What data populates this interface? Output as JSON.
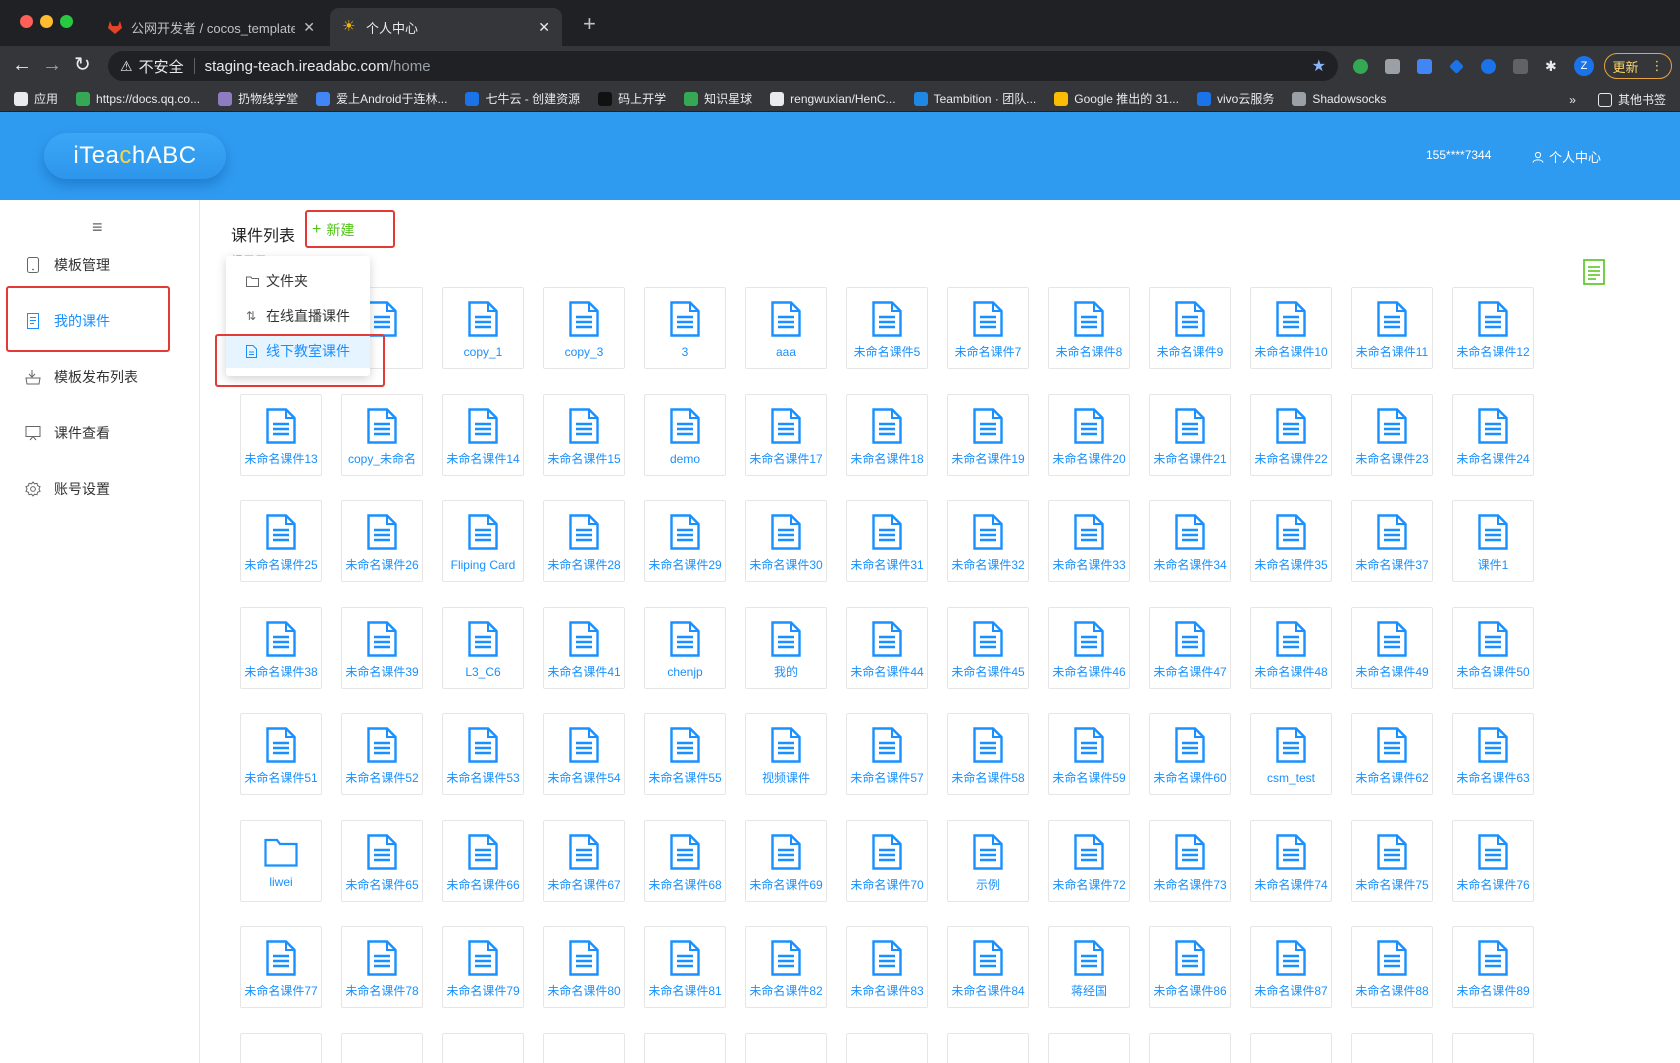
{
  "browser": {
    "tabs": [
      {
        "title": "公网开发者 / cocos_template_",
        "active": false
      },
      {
        "title": "个人中心",
        "active": true
      }
    ],
    "security_label": "不安全",
    "url_host": "staging-teach.ireadabc.com",
    "url_path": "/home",
    "profile_initial": "Z",
    "update_label": "更新",
    "bookmarks": [
      {
        "label": "应用",
        "color": "#e8eaed"
      },
      {
        "label": "https://docs.qq.co...",
        "color": "#34a853"
      },
      {
        "label": "扔物线学堂",
        "color": "#8e7cc3"
      },
      {
        "label": "爱上Android于连林...",
        "color": "#4285f4"
      },
      {
        "label": "七牛云 - 创建资源",
        "color": "#1a73e8"
      },
      {
        "label": "码上开学",
        "color": "#111111"
      },
      {
        "label": "知识星球",
        "color": "#34a853"
      },
      {
        "label": "rengwuxian/HenC...",
        "color": "#e8eaed"
      },
      {
        "label": "Teambition · 团队...",
        "color": "#1e88e5"
      },
      {
        "label": "Google 推出的 31...",
        "color": "#fbbc04"
      },
      {
        "label": "vivo云服务",
        "color": "#1a73e8"
      },
      {
        "label": "Shadowsocks",
        "color": "#9aa0a6"
      }
    ],
    "bookmarks_more": "»",
    "other_bookmarks": "其他书签"
  },
  "header": {
    "logo_pre": "iTea",
    "logo_accent": "c",
    "logo_post": "hABC",
    "phone": "155****7344",
    "user_center": "个人中心"
  },
  "sidebar": {
    "items": [
      {
        "label": "模板管理",
        "icon": "tablet-icon",
        "active": false
      },
      {
        "label": "我的课件",
        "icon": "document-icon",
        "active": true
      },
      {
        "label": "模板发布列表",
        "icon": "publish-icon",
        "active": false
      },
      {
        "label": "课件查看",
        "icon": "monitor-icon",
        "active": false
      },
      {
        "label": "账号设置",
        "icon": "gear-icon",
        "active": false
      }
    ]
  },
  "main": {
    "title": "课件列表",
    "new_label": "新建",
    "hidden_label": "根目录",
    "dropdown": [
      {
        "label": "文件夹",
        "icon": "folder-icon"
      },
      {
        "label": "在线直播课件",
        "icon": "sort-icon"
      },
      {
        "label": "线下教室课件",
        "icon": "file-icon"
      }
    ],
    "items": [
      {
        "label": "",
        "type": "file"
      },
      {
        "label": "",
        "type": "file"
      },
      {
        "label": "copy_1",
        "type": "file"
      },
      {
        "label": "copy_3",
        "type": "file"
      },
      {
        "label": "3",
        "type": "file"
      },
      {
        "label": "aaa",
        "type": "file"
      },
      {
        "label": "未命名课件5",
        "type": "file"
      },
      {
        "label": "未命名课件7",
        "type": "file"
      },
      {
        "label": "未命名课件8",
        "type": "file"
      },
      {
        "label": "未命名课件9",
        "type": "file"
      },
      {
        "label": "未命名课件10",
        "type": "file"
      },
      {
        "label": "未命名课件11",
        "type": "file"
      },
      {
        "label": "未命名课件12",
        "type": "file"
      },
      {
        "label": "未命名课件13",
        "type": "file"
      },
      {
        "label": "copy_未命名",
        "type": "file"
      },
      {
        "label": "未命名课件14",
        "type": "file"
      },
      {
        "label": "未命名课件15",
        "type": "file"
      },
      {
        "label": "demo",
        "type": "file"
      },
      {
        "label": "未命名课件17",
        "type": "file"
      },
      {
        "label": "未命名课件18",
        "type": "file"
      },
      {
        "label": "未命名课件19",
        "type": "file"
      },
      {
        "label": "未命名课件20",
        "type": "file"
      },
      {
        "label": "未命名课件21",
        "type": "file"
      },
      {
        "label": "未命名课件22",
        "type": "file"
      },
      {
        "label": "未命名课件23",
        "type": "file"
      },
      {
        "label": "未命名课件24",
        "type": "file"
      },
      {
        "label": "未命名课件25",
        "type": "file"
      },
      {
        "label": "未命名课件26",
        "type": "file"
      },
      {
        "label": "Fliping Card",
        "type": "file"
      },
      {
        "label": "未命名课件28",
        "type": "file"
      },
      {
        "label": "未命名课件29",
        "type": "file"
      },
      {
        "label": "未命名课件30",
        "type": "file"
      },
      {
        "label": "未命名课件31",
        "type": "file"
      },
      {
        "label": "未命名课件32",
        "type": "file"
      },
      {
        "label": "未命名课件33",
        "type": "file"
      },
      {
        "label": "未命名课件34",
        "type": "file"
      },
      {
        "label": "未命名课件35",
        "type": "file"
      },
      {
        "label": "未命名课件37",
        "type": "file"
      },
      {
        "label": "课件1",
        "type": "file"
      },
      {
        "label": "未命名课件38",
        "type": "file"
      },
      {
        "label": "未命名课件39",
        "type": "file"
      },
      {
        "label": "L3_C6",
        "type": "file"
      },
      {
        "label": "未命名课件41",
        "type": "file"
      },
      {
        "label": "chenjp",
        "type": "file"
      },
      {
        "label": "我的",
        "type": "file"
      },
      {
        "label": "未命名课件44",
        "type": "file"
      },
      {
        "label": "未命名课件45",
        "type": "file"
      },
      {
        "label": "未命名课件46",
        "type": "file"
      },
      {
        "label": "未命名课件47",
        "type": "file"
      },
      {
        "label": "未命名课件48",
        "type": "file"
      },
      {
        "label": "未命名课件49",
        "type": "file"
      },
      {
        "label": "未命名课件50",
        "type": "file"
      },
      {
        "label": "未命名课件51",
        "type": "file"
      },
      {
        "label": "未命名课件52",
        "type": "file"
      },
      {
        "label": "未命名课件53",
        "type": "file"
      },
      {
        "label": "未命名课件54",
        "type": "file"
      },
      {
        "label": "未命名课件55",
        "type": "file"
      },
      {
        "label": "视频课件",
        "type": "file"
      },
      {
        "label": "未命名课件57",
        "type": "file"
      },
      {
        "label": "未命名课件58",
        "type": "file"
      },
      {
        "label": "未命名课件59",
        "type": "file"
      },
      {
        "label": "未命名课件60",
        "type": "file"
      },
      {
        "label": "csm_test",
        "type": "file"
      },
      {
        "label": "未命名课件62",
        "type": "file"
      },
      {
        "label": "未命名课件63",
        "type": "file"
      },
      {
        "label": "liwei",
        "type": "folder"
      },
      {
        "label": "未命名课件65",
        "type": "file"
      },
      {
        "label": "未命名课件66",
        "type": "file"
      },
      {
        "label": "未命名课件67",
        "type": "file"
      },
      {
        "label": "未命名课件68",
        "type": "file"
      },
      {
        "label": "未命名课件69",
        "type": "file"
      },
      {
        "label": "未命名课件70",
        "type": "file"
      },
      {
        "label": "示例",
        "type": "file"
      },
      {
        "label": "未命名课件72",
        "type": "file"
      },
      {
        "label": "未命名课件73",
        "type": "file"
      },
      {
        "label": "未命名课件74",
        "type": "file"
      },
      {
        "label": "未命名课件75",
        "type": "file"
      },
      {
        "label": "未命名课件76",
        "type": "file"
      },
      {
        "label": "未命名课件77",
        "type": "file"
      },
      {
        "label": "未命名课件78",
        "type": "file"
      },
      {
        "label": "未命名课件79",
        "type": "file"
      },
      {
        "label": "未命名课件80",
        "type": "file"
      },
      {
        "label": "未命名课件81",
        "type": "file"
      },
      {
        "label": "未命名课件82",
        "type": "file"
      },
      {
        "label": "未命名课件83",
        "type": "file"
      },
      {
        "label": "未命名课件84",
        "type": "file"
      },
      {
        "label": "蒋经国",
        "type": "file"
      },
      {
        "label": "未命名课件86",
        "type": "file"
      },
      {
        "label": "未命名课件87",
        "type": "file"
      },
      {
        "label": "未命名课件88",
        "type": "file"
      },
      {
        "label": "未命名课件89",
        "type": "file"
      }
    ]
  },
  "colors": {
    "header_bg": "#2f9bf0",
    "accent": "#1890ff",
    "new_green": "#52c41a",
    "annotation_red": "#e53935"
  }
}
